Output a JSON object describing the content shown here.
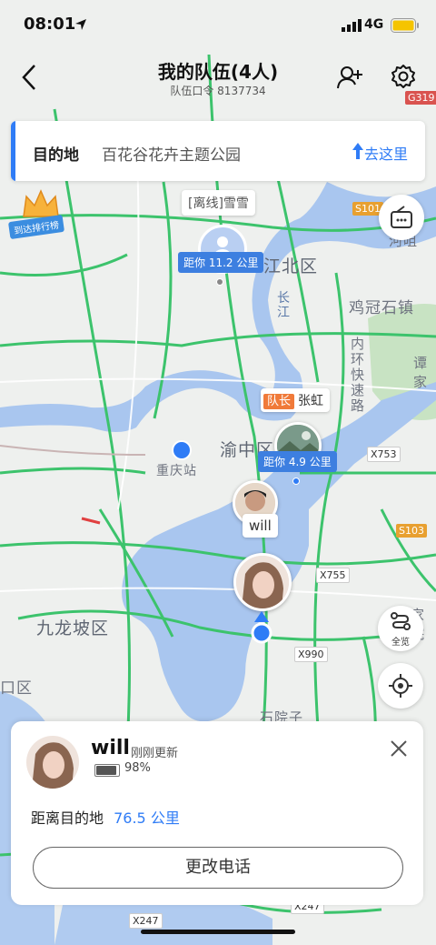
{
  "status_bar": {
    "time": "08:01",
    "network": "4G"
  },
  "header": {
    "title": "我的队伍(4人)",
    "subtitle": "队伍口令 8137734"
  },
  "destination": {
    "label": "目的地",
    "value": "百花谷花卉主题公园",
    "go_label": "去这里"
  },
  "badge": {
    "ranking_label": "到达排行榜"
  },
  "side_buttons": {
    "overview_label": "全览"
  },
  "map": {
    "labels": {
      "jiangbei": "江北区",
      "yuzhong": "渝中区",
      "jiulongpo": "九龙坡区",
      "jiguanshi": "鸡冠石镇",
      "neihuan": "内环快速路",
      "yangtze": "长江",
      "chongqing_station": "重庆站",
      "shiyuanzi": "石院子",
      "hezui": "河咀",
      "tanjia": "谭家",
      "left_edge": "口区",
      "right_edge": "家院"
    },
    "roads": [
      "G319",
      "S101",
      "X753",
      "S103",
      "X755",
      "X990",
      "X247",
      "X247"
    ],
    "colors": {
      "road": "#3cc36c",
      "water": "#a9c6ef",
      "accent": "#2f7cf6"
    }
  },
  "members": [
    {
      "name": "[离线]雪雪",
      "distance": "距你 11.2 公里",
      "offline": true
    },
    {
      "role": "队长",
      "name": "张虹",
      "distance": "距你 4.9 公里"
    },
    {
      "name": "will"
    }
  ],
  "card": {
    "name": "will",
    "update": "刚刚更新",
    "battery": "98%",
    "battery_level": 0.98,
    "distance_label": "距离目的地",
    "distance_value": "76.5 公里",
    "button_label": "更改电话"
  }
}
